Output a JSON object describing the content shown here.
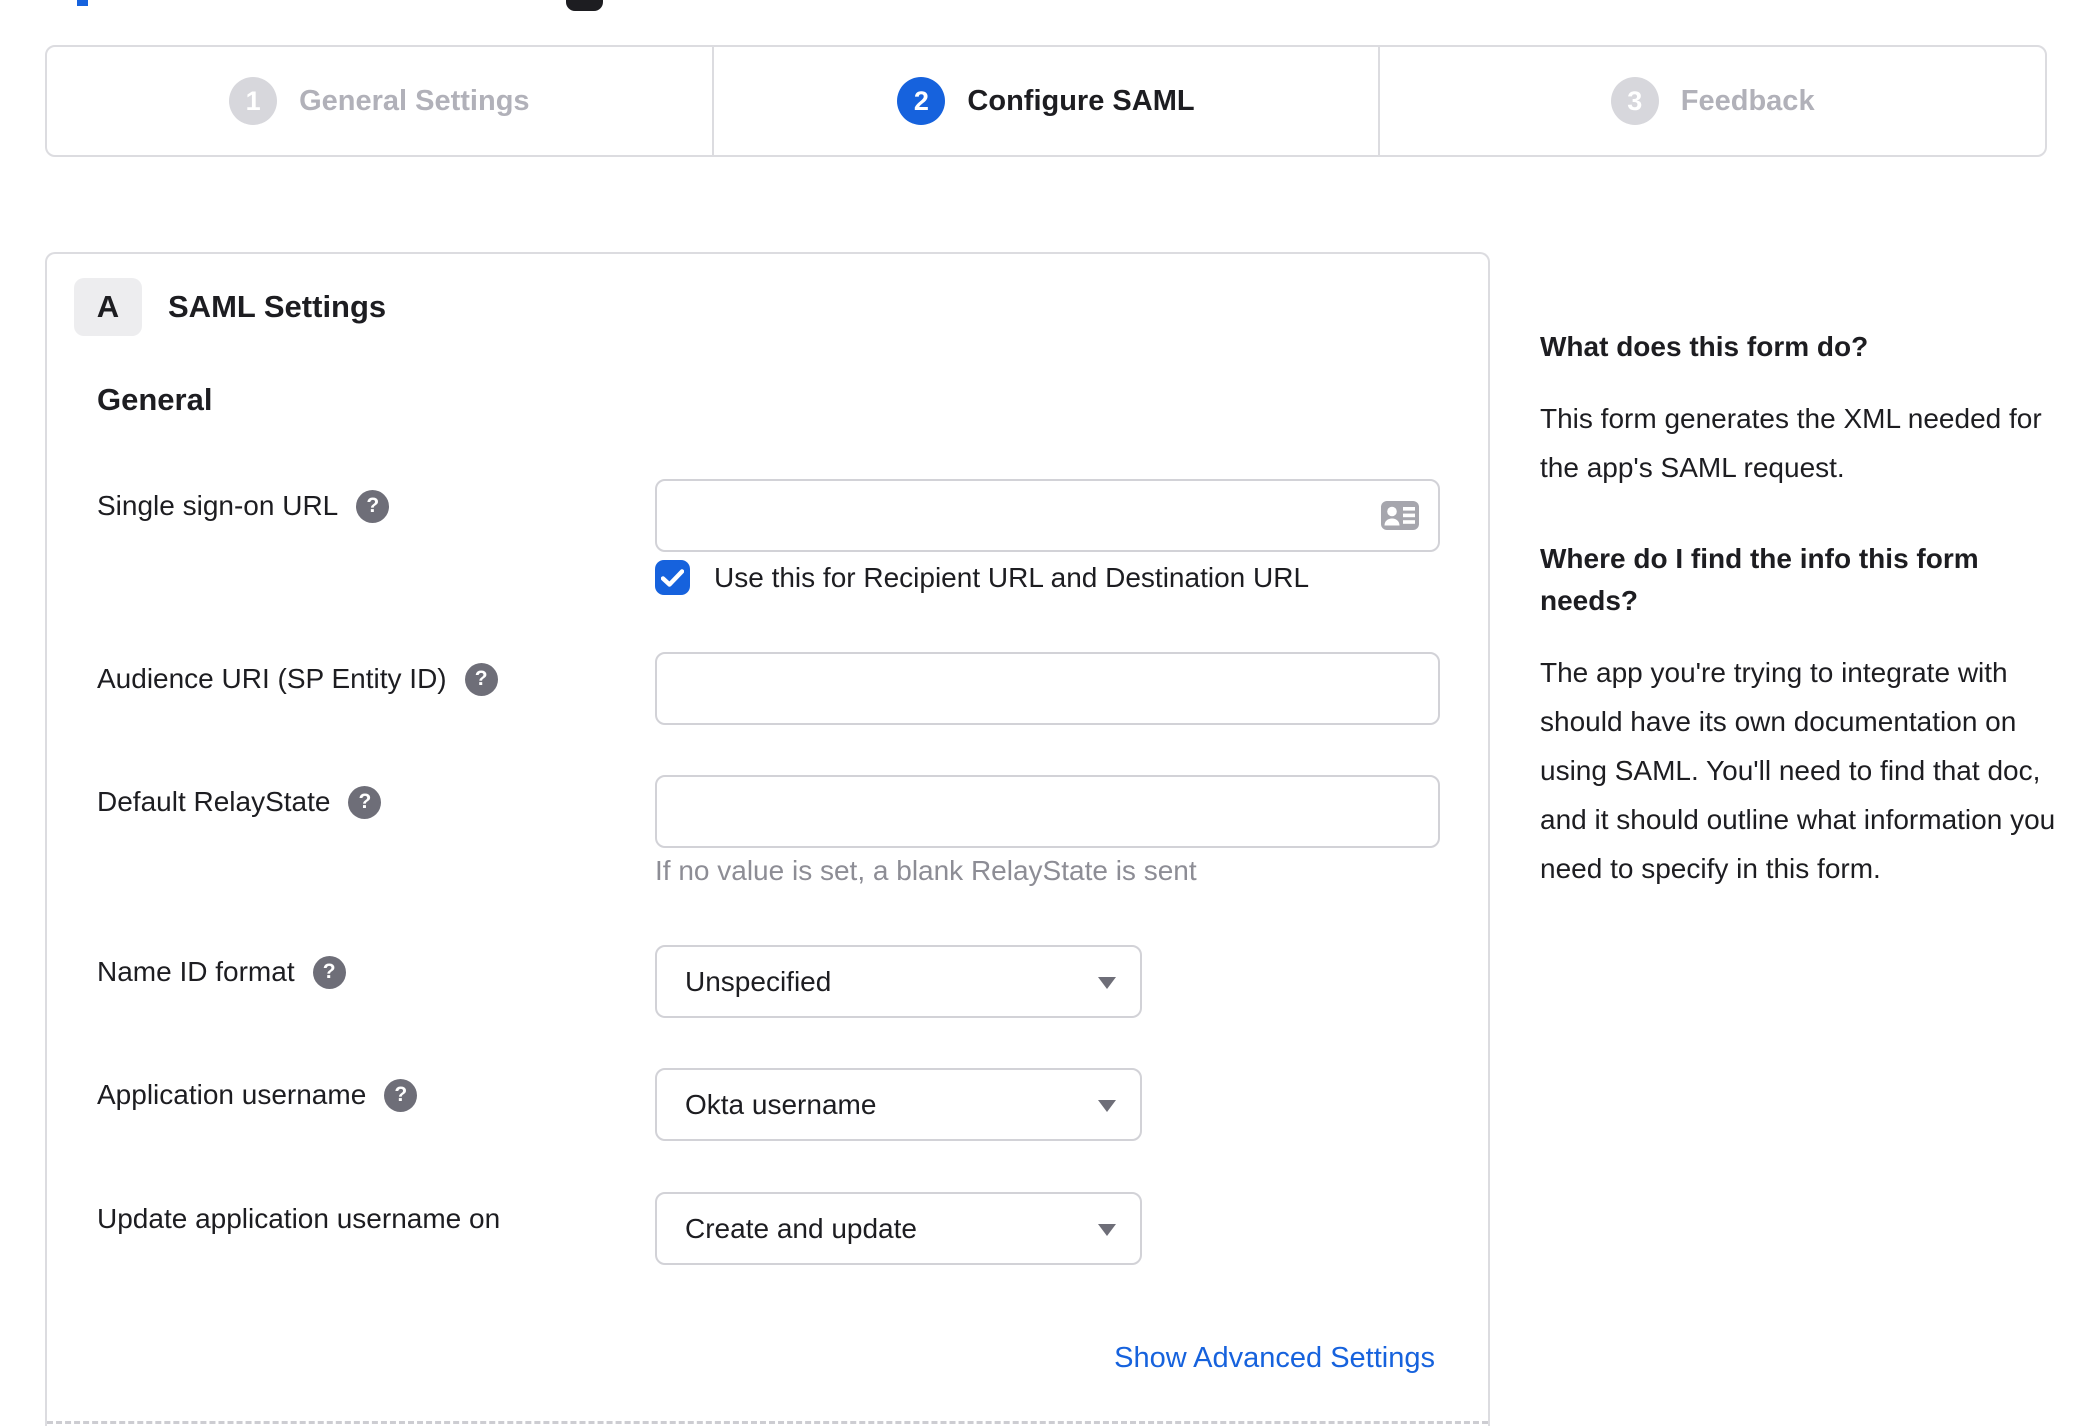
{
  "colors": {
    "accent_blue": "#1662dd",
    "border_gray": "#d7d7dc",
    "text_dark": "#1d1d21",
    "inactive_gray": "#b1b1b9",
    "hint_gray": "#8d8d95"
  },
  "stepper": {
    "steps": [
      {
        "number": "1",
        "label": "General Settings",
        "state": "inactive"
      },
      {
        "number": "2",
        "label": "Configure SAML",
        "state": "active"
      },
      {
        "number": "3",
        "label": "Feedback",
        "state": "inactive"
      }
    ]
  },
  "panel": {
    "section_badge": "A",
    "section_title": "SAML Settings",
    "group_heading": "General",
    "fields": {
      "sso_url": {
        "label": "Single sign-on URL",
        "value": "",
        "has_help": true
      },
      "sso_checkbox": {
        "label": "Use this for Recipient URL and Destination URL",
        "checked": true
      },
      "audience_uri": {
        "label": "Audience URI (SP Entity ID)",
        "value": "",
        "has_help": true
      },
      "default_relaystate": {
        "label": "Default RelayState",
        "value": "",
        "hint": "If no value is set, a blank RelayState is sent",
        "has_help": true
      },
      "name_id_format": {
        "label": "Name ID format",
        "value": "Unspecified",
        "has_help": true
      },
      "application_username": {
        "label": "Application username",
        "value": "Okta username",
        "has_help": true
      },
      "update_app_username_on": {
        "label": "Update application username on",
        "value": "Create and update",
        "has_help": false
      }
    },
    "advanced_link": "Show Advanced Settings"
  },
  "sidebar": {
    "sections": [
      {
        "heading": "What does this form do?",
        "body": "This form generates the XML needed for the app's SAML request."
      },
      {
        "heading": "Where do I find the info this form needs?",
        "body": "The app you're trying to integrate with should have its own documentation on using SAML. You'll need to find that doc, and it should outline what information you need to specify in this form."
      }
    ]
  }
}
